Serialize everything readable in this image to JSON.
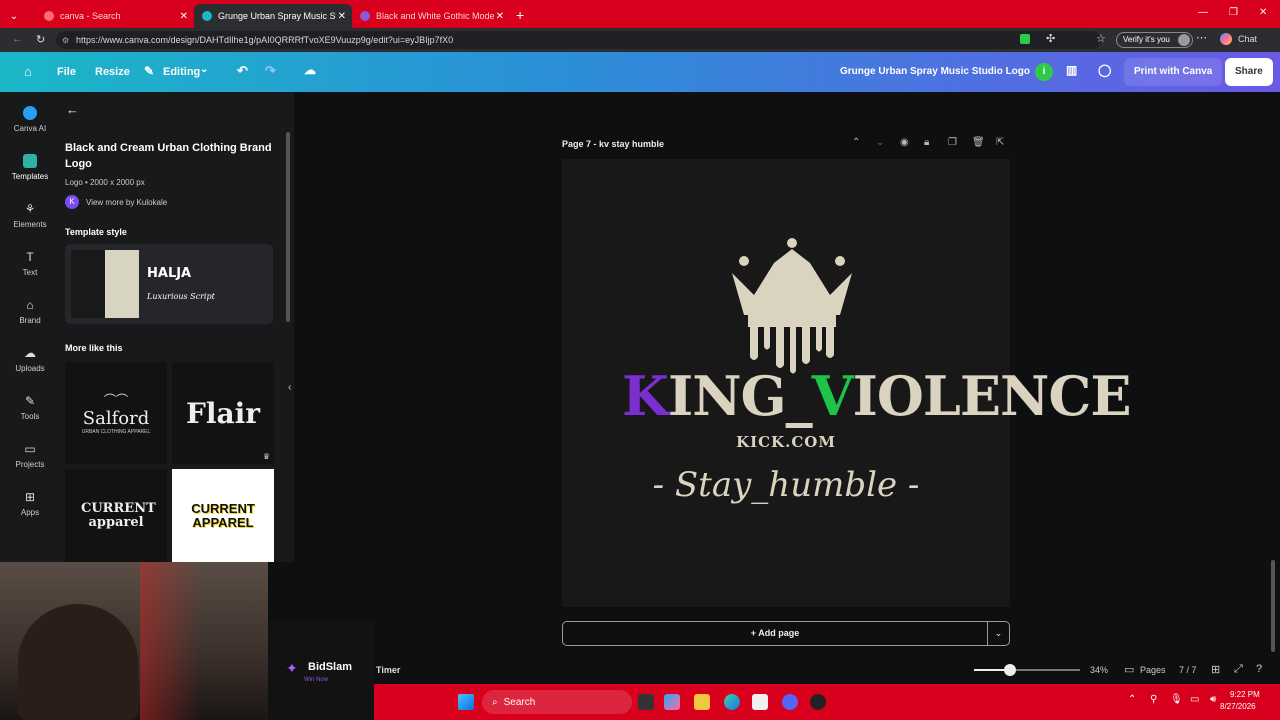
{
  "browser": {
    "tabs": [
      {
        "label": "canva - Search",
        "active": false
      },
      {
        "label": "Grunge Urban Spray Music Studio",
        "active": true
      },
      {
        "label": "Black and White Gothic Modern",
        "active": false
      }
    ],
    "url": "https://www.canva.com/design/DAHTdIlhe1g/pAI0QRRRfTvoXE9Vuuzp9g/edit?ui=eyJBIjp7fX0",
    "verify_label": "Verify it's you",
    "chat_label": "Chat"
  },
  "canva_header": {
    "file": "File",
    "resize": "Resize",
    "editing": "Editing",
    "design_title": "Grunge Urban Spray Music Studio Logo",
    "info_badge": "i",
    "print": "Print with Canva",
    "share": "Share"
  },
  "rail": [
    {
      "label": "Canva AI",
      "icon": "canva-ai-icon"
    },
    {
      "label": "Templates",
      "icon": "templates-icon"
    },
    {
      "label": "Elements",
      "icon": "elements-icon"
    },
    {
      "label": "Text",
      "icon": "text-icon"
    },
    {
      "label": "Brand",
      "icon": "brand-icon"
    },
    {
      "label": "Uploads",
      "icon": "uploads-icon"
    },
    {
      "label": "Tools",
      "icon": "tools-icon"
    },
    {
      "label": "Projects",
      "icon": "projects-icon"
    },
    {
      "label": "Apps",
      "icon": "apps-icon"
    }
  ],
  "panel": {
    "title": "Black and Cream Urban Clothing Brand Logo",
    "subtitle": "Logo • 2000 x 2000 px",
    "author_initial": "K",
    "author_link": "View more by Kulokale",
    "template_style_heading": "Template style",
    "style_font_1": "HALJA",
    "style_font_2": "Luxurious Script",
    "more_heading": "More like this",
    "thumbs": [
      {
        "title": "Salford",
        "sub": "URBAN CLOTHING APPAREL"
      },
      {
        "title": "Flair",
        "sub": ""
      },
      {
        "title": "CURRENT apparel",
        "sub": ""
      },
      {
        "title": "CURRENT APPAREL",
        "sub": ""
      }
    ]
  },
  "canvas": {
    "page_label": "Page 7 - kv stay humble",
    "logo_text_k": "K",
    "logo_text_1": "ING_",
    "logo_text_v": "V",
    "logo_text_2": "IOLENCE",
    "logo_sub": "KICK.COM",
    "logo_tagline": "- Stay_humble -",
    "add_page": "+ Add page"
  },
  "bottom_bar": {
    "timer": "Timer",
    "zoom": "34%",
    "pages_label": "Pages",
    "page_count": "7 / 7"
  },
  "overlay": {
    "sponsor": "BidSlam",
    "sponsor_sub": "Win Now"
  },
  "taskbar": {
    "search": "Search",
    "time": "9:22 PM",
    "date": "8/27/2026"
  },
  "colors": {
    "tab_red": "#d8001c",
    "purple": "#7b2fd1",
    "green": "#1fc34a",
    "cream": "#d9d3bf"
  }
}
